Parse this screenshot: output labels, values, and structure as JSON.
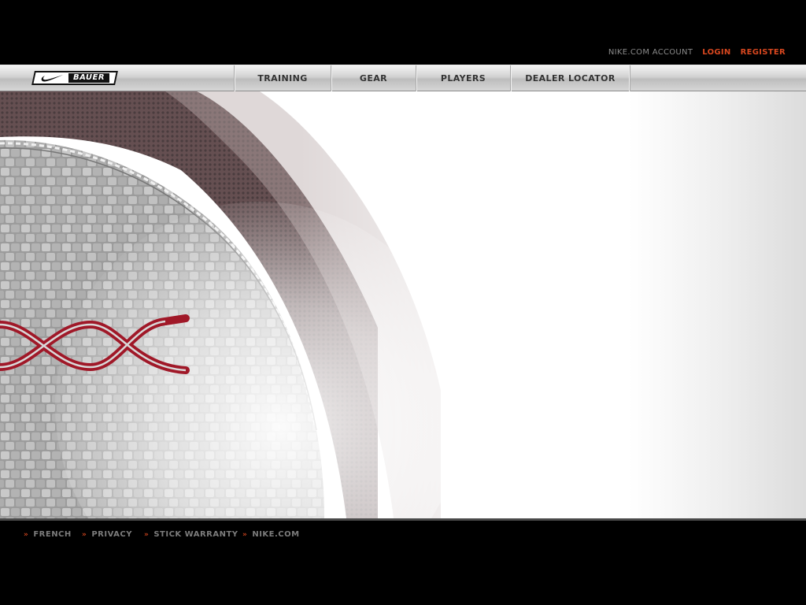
{
  "account": {
    "nike_account": "NIKE.COM ACCOUNT",
    "login": "LOGIN",
    "register": "REGISTER"
  },
  "logo": {
    "brand": "BAUER"
  },
  "nav": {
    "items": [
      {
        "label": "TRAINING"
      },
      {
        "label": "GEAR"
      },
      {
        "label": "PLAYERS"
      },
      {
        "label": "DEALER LOCATOR"
      }
    ]
  },
  "footer": {
    "links": [
      {
        "label": "FRENCH"
      },
      {
        "label": "PRIVACY"
      },
      {
        "label": "STICK WARRANTY"
      },
      {
        "label": "NIKE.COM"
      }
    ]
  },
  "colors": {
    "background": "#000000",
    "accent": "#d8471f",
    "nav_text": "#333333",
    "muted_text": "#8a8a8a",
    "emblem_red": "#a01828"
  },
  "icons": {
    "logo": "nike-swoosh-icon",
    "footer_arrow": "double-chevron-right-icon"
  }
}
